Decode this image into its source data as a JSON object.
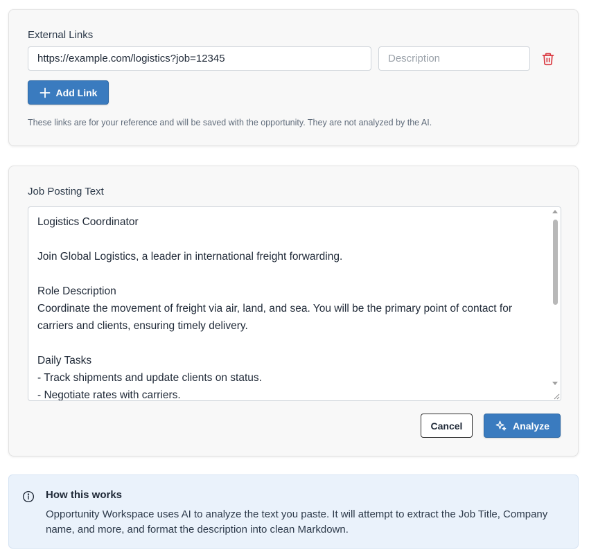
{
  "links": {
    "label": "External Links",
    "url_value": "https://example.com/logistics?job=12345",
    "description_placeholder": "Description",
    "add_link_label": "Add Link",
    "help_text": "These links are for your reference and will be saved with the opportunity. They are not analyzed by the AI."
  },
  "job": {
    "label": "Job Posting Text",
    "text": "Logistics Coordinator\n\nJoin Global Logistics, a leader in international freight forwarding.\n\nRole Description\nCoordinate the movement of freight via air, land, and sea. You will be the primary point of contact for carriers and clients, ensuring timely delivery.\n\nDaily Tasks\n- Track shipments and update clients on status.\n- Negotiate rates with carriers.",
    "cancel_label": "Cancel",
    "analyze_label": "Analyze"
  },
  "info": {
    "title": "How this works",
    "body": "Opportunity Workspace uses AI to analyze the text you paste. It will attempt to extract the Job Title, Company name, and more, and format the description into clean Markdown."
  },
  "icons": {
    "add": "plus-icon",
    "delete": "trash-icon",
    "analyze": "sparkle-icon",
    "info": "info-icon"
  },
  "colors": {
    "primary": "#3a7bbf",
    "danger": "#d9363e",
    "info_bg": "#eaf2fb"
  }
}
